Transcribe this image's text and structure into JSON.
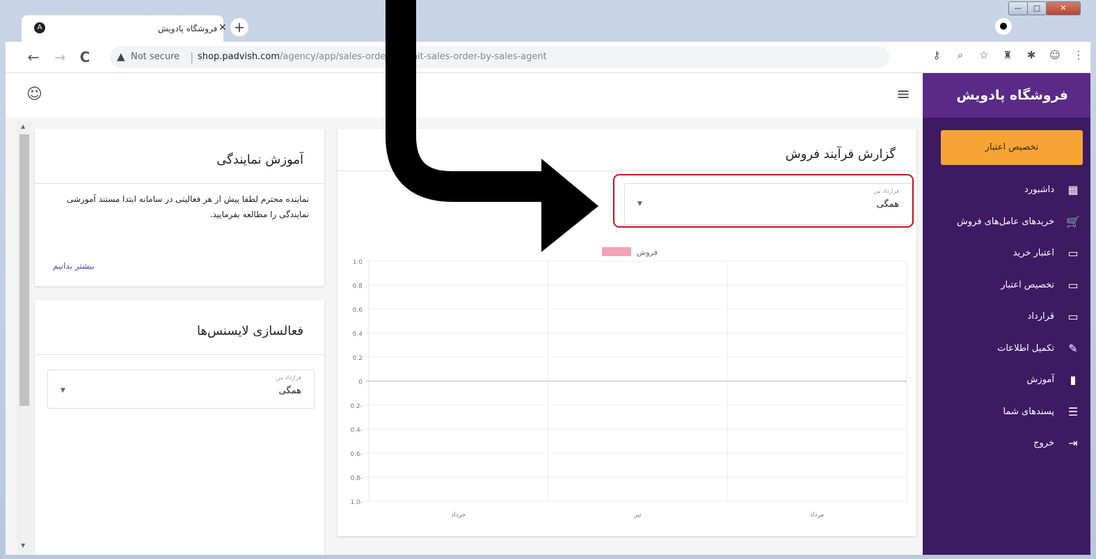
{
  "browser": {
    "tab_title": "فروشگاه پادویش",
    "tab_close": "✕",
    "new_tab": "+",
    "window_buttons": {
      "minimize": "—",
      "maximize": "□",
      "close": "✕"
    },
    "nav": {
      "back": "←",
      "forward": "→",
      "reload": "C"
    },
    "security_label": "Not secure",
    "url_host": "shop.padvish.com",
    "url_path": "/agency/app/sales-order/submit-sales-order-by-sales-agent"
  },
  "app": {
    "brand": "فروشگاه پادویش",
    "allocate_button": "تخصیص اعتبار",
    "menu": [
      {
        "label": "داشبورد",
        "icon": "dashboard-icon"
      },
      {
        "label": "خریدهای عامل‌های فروش",
        "icon": "cart-icon"
      },
      {
        "label": "اعتبار خرید",
        "icon": "card-icon"
      },
      {
        "label": "تخصیص اعتبار",
        "icon": "card-icon"
      },
      {
        "label": "قرارداد",
        "icon": "card-icon"
      },
      {
        "label": "تکمیل اطلاعات",
        "icon": "pencil-icon"
      },
      {
        "label": "آموزش",
        "icon": "book-icon"
      },
      {
        "label": "پسندهای شما",
        "icon": "playlist-check-icon"
      },
      {
        "label": "خروج",
        "icon": "logout-icon"
      }
    ]
  },
  "training": {
    "title": "آموزش نمایندگی",
    "body": "نماینده محترم لطفا پیش از هر فعالیتی در سامانه ابتدا مستند آموزشی نمایندگی را مطالعه بفرمایید.",
    "more": "بیشتر بدانیم"
  },
  "license": {
    "title": "فعالسازی لایسنس‌ها",
    "select_label": "قرارداد من",
    "select_value": "همگی"
  },
  "report": {
    "title": "گزارش فرآیند فروش",
    "select_label": "قرارداد من",
    "select_value": "همگی"
  },
  "chart_data": {
    "type": "bar",
    "categories": [
      "خرداد",
      "تیر",
      "مرداد"
    ],
    "series": [
      {
        "name": "فروش",
        "values": [
          0,
          0,
          0
        ],
        "color": "#f4a3b4"
      }
    ],
    "yticks": [
      "1.0",
      "0.8",
      "0.6",
      "0.4",
      "0.2",
      "0",
      "0.2-",
      "0.4-",
      "0.6-",
      "0.8-",
      "1.0-"
    ],
    "ylim": [
      -1,
      1
    ],
    "grid": true,
    "legend_position": "top"
  }
}
